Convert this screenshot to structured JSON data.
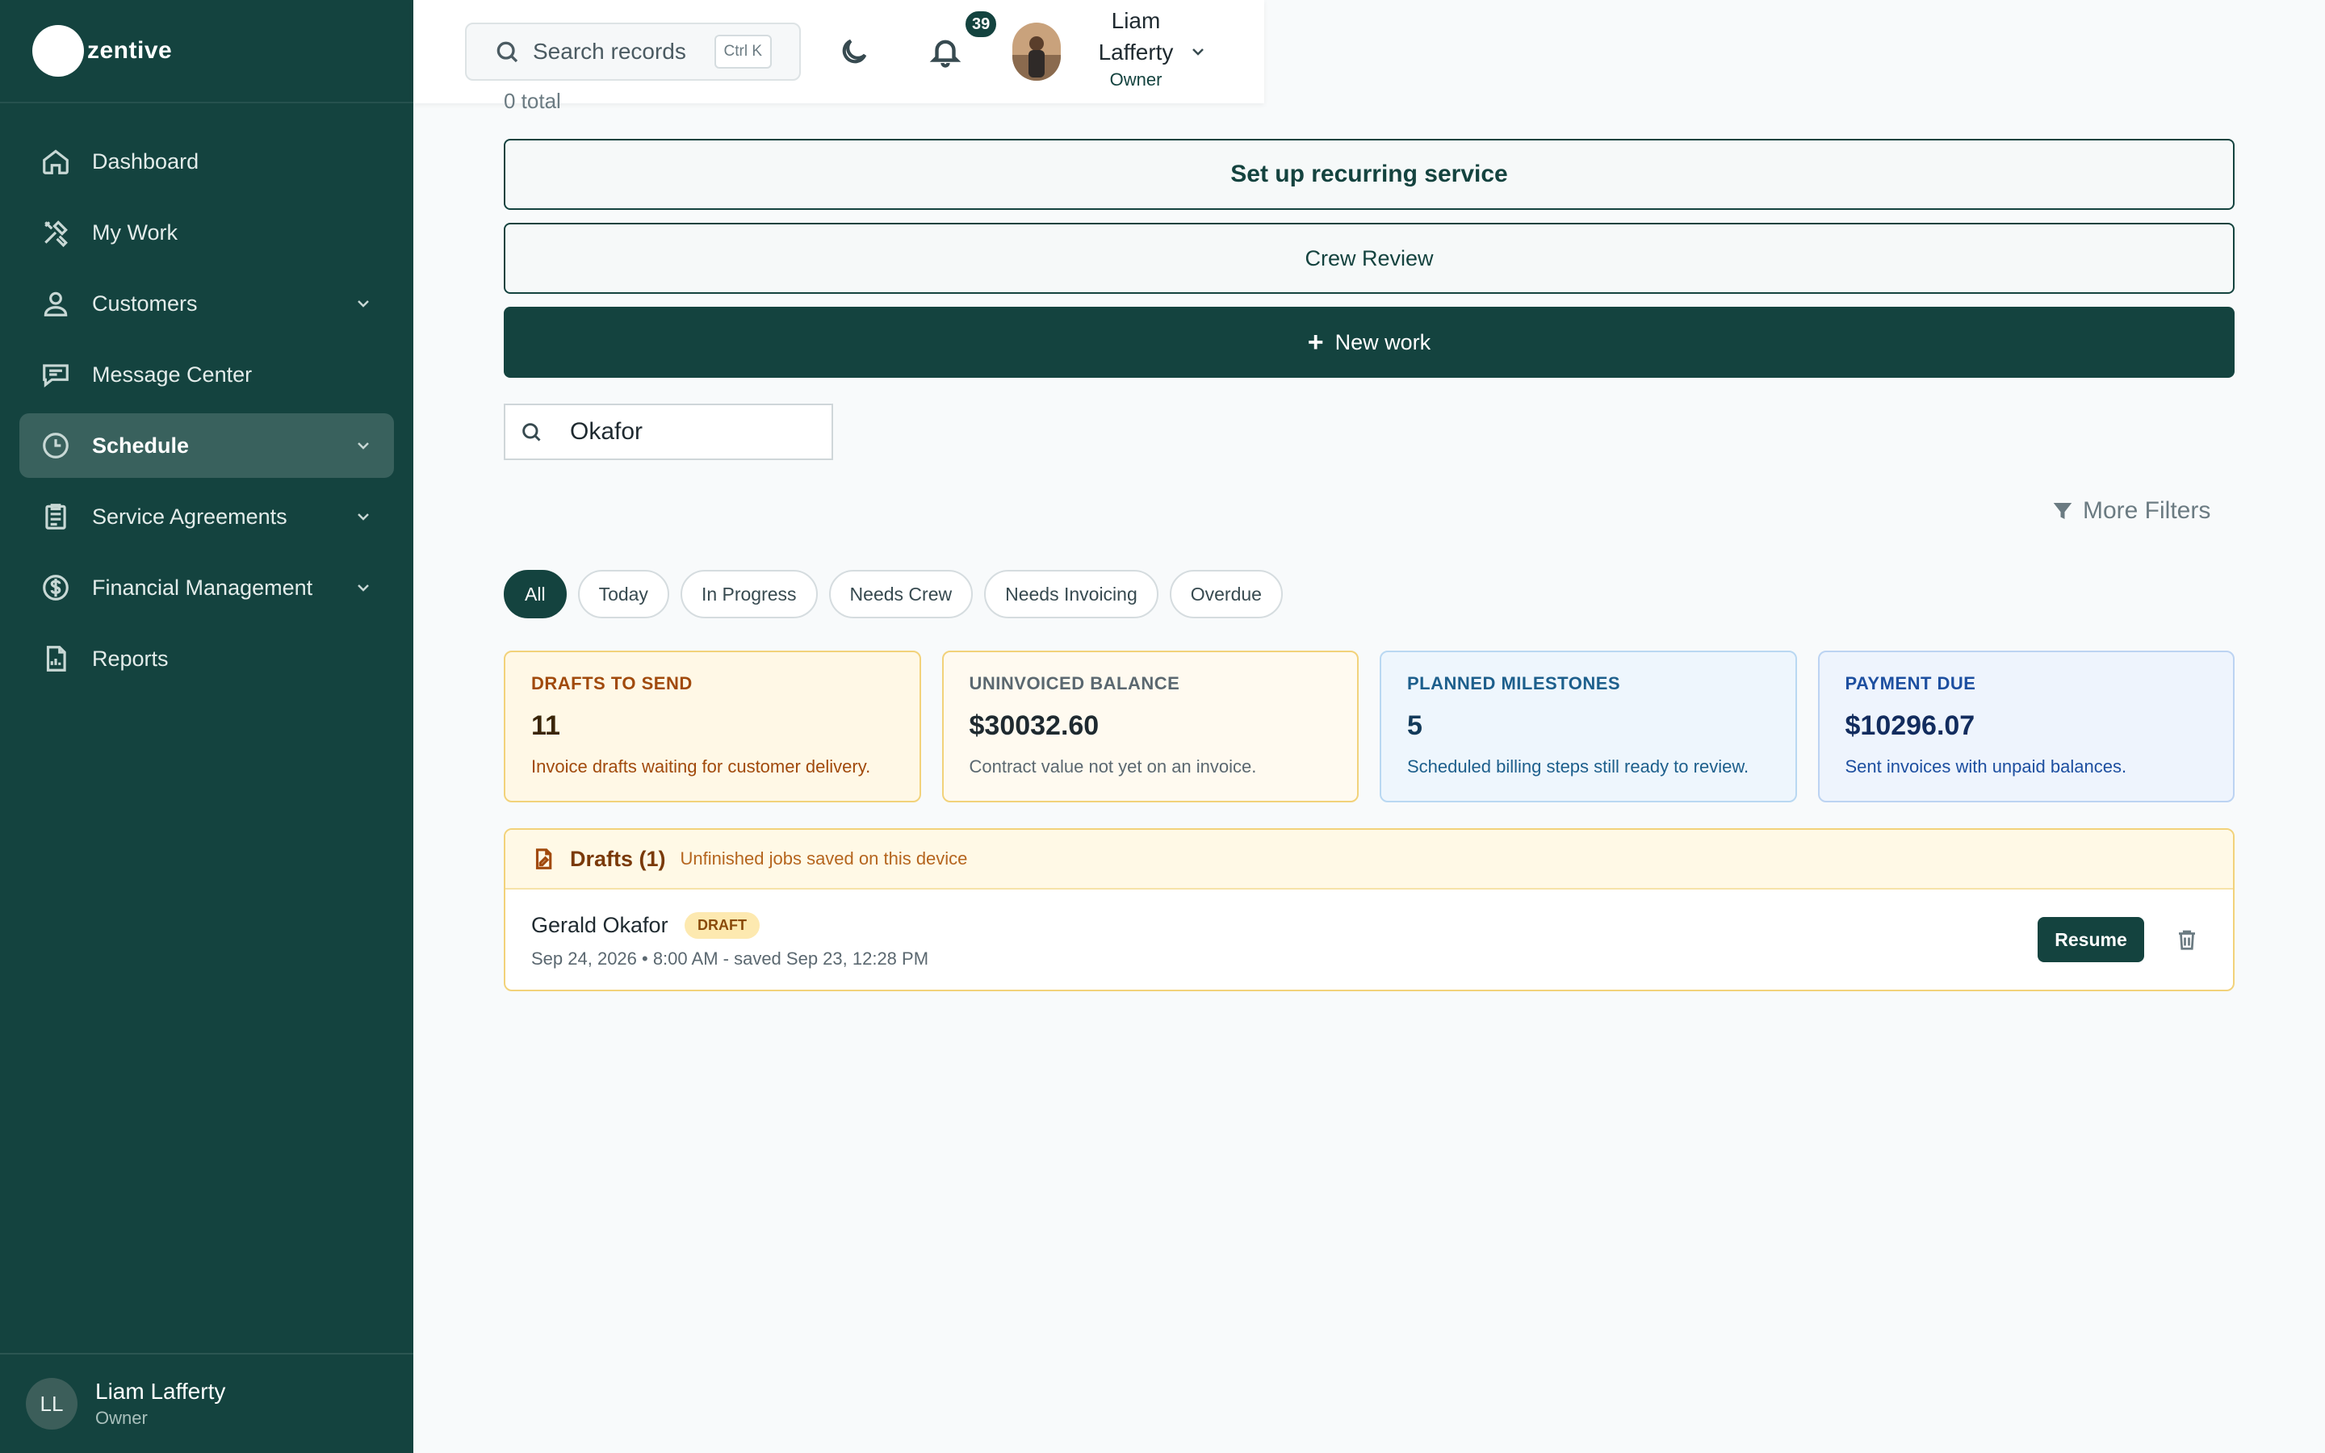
{
  "brand": {
    "name": "zentive"
  },
  "sidebar": {
    "items": [
      {
        "label": "Dashboard",
        "icon": "home-icon"
      },
      {
        "label": "My Work",
        "icon": "tools-icon"
      },
      {
        "label": "Customers",
        "icon": "users-icon"
      },
      {
        "label": "Message Center",
        "icon": "chat-icon"
      },
      {
        "label": "Schedule",
        "icon": "clock-icon"
      },
      {
        "label": "Service Agreements",
        "icon": "clipboard-icon"
      },
      {
        "label": "Financial Management",
        "icon": "dollar-icon"
      },
      {
        "label": "Reports",
        "icon": "report-icon"
      }
    ],
    "active": "Schedule",
    "footer": {
      "initials": "LL",
      "name": "Liam Lafferty",
      "role": "Owner"
    }
  },
  "topbar": {
    "search_placeholder": "Search records",
    "shortcut": "Ctrl K",
    "notification_count": "39",
    "user_name": "Liam Lafferty",
    "user_role": "Owner"
  },
  "main": {
    "total_text": "0 total",
    "recurring_label": "Set up recurring service",
    "crew_review_label": "Crew Review",
    "new_work_label": "New work",
    "search_value": "Okafor",
    "more_filters_label": "More Filters",
    "chips": [
      "All",
      "Today",
      "In Progress",
      "Needs Crew",
      "Needs Invoicing",
      "Overdue"
    ],
    "active_chip": "All",
    "cards": [
      {
        "label": "DRAFTS TO SEND",
        "value": "11",
        "desc": "Invoice drafts waiting for customer delivery."
      },
      {
        "label": "UNINVOICED BALANCE",
        "value": "$30032.60",
        "desc": "Contract value not yet on an invoice."
      },
      {
        "label": "PLANNED MILESTONES",
        "value": "5",
        "desc": "Scheduled billing steps still ready to review."
      },
      {
        "label": "PAYMENT DUE",
        "value": "$10296.07",
        "desc": "Sent invoices with unpaid balances."
      }
    ],
    "drafts": {
      "title": "Drafts (1)",
      "subtitle": "Unfinished jobs saved on this device",
      "items": [
        {
          "name": "Gerald Okafor",
          "badge": "DRAFT",
          "meta": "Sep 24, 2026 • 8:00 AM - saved Sep 23, 12:28 PM",
          "resume_label": "Resume"
        }
      ]
    }
  },
  "colors": {
    "brand": "#14433f",
    "amber": "#f2d27a",
    "blue": "#b9d8f2"
  }
}
